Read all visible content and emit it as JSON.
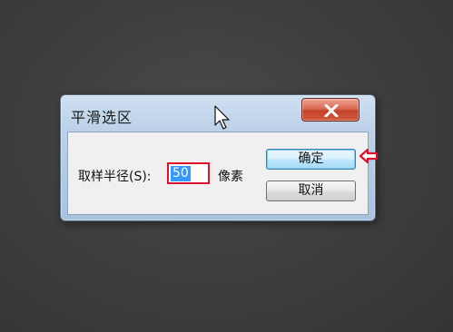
{
  "dialog": {
    "title": "平滑选区",
    "close_icon": "close-x-icon",
    "radius_label": "取样半径(S):",
    "radius_value": "50",
    "unit_label": "像素",
    "ok_label": "确定",
    "cancel_label": "取消"
  },
  "annotation": {
    "arrow_icon": "red-arrow-left-icon",
    "highlight_color": "#e0102a"
  },
  "cursor": {
    "icon": "mouse-pointer-icon"
  },
  "colors": {
    "close_button": "#c2412a",
    "selection": "#3399ff",
    "ok_button_border": "#3c7fb1"
  }
}
